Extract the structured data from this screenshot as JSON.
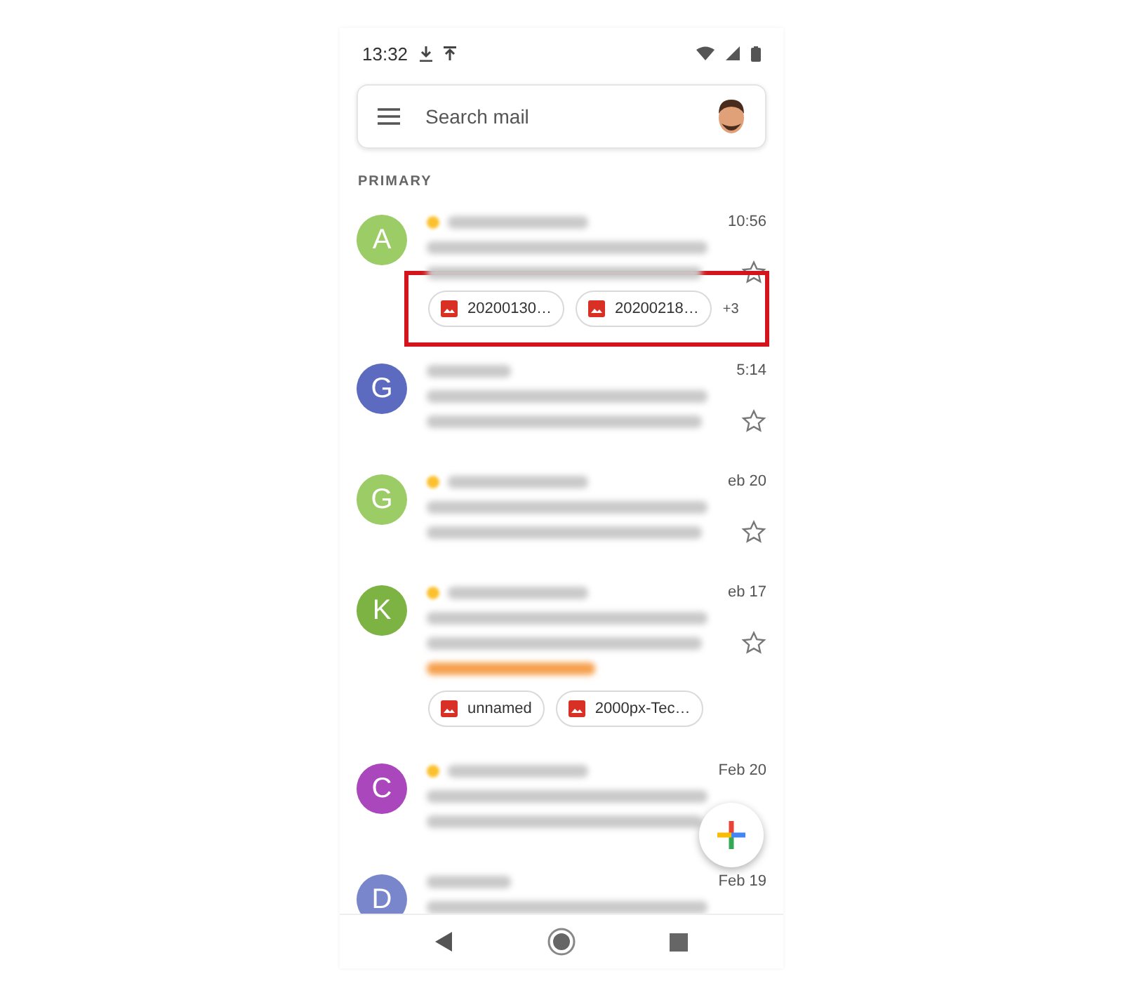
{
  "status_bar": {
    "time": "13:32"
  },
  "search": {
    "placeholder": "Search mail"
  },
  "section_label": "PRIMARY",
  "emails": [
    {
      "avatar": "A",
      "color": "#9ccc65",
      "important": true,
      "time": "10:56",
      "starred": false,
      "attachments": [
        "20200130…",
        "20200218…"
      ],
      "more": "+3",
      "highlighted": true,
      "follow_up": false
    },
    {
      "avatar": "G",
      "color": "#5c6bc0",
      "important": false,
      "time": "5:14",
      "starred": false,
      "highlighted": false,
      "follow_up": false
    },
    {
      "avatar": "G",
      "color": "#9ccc65",
      "important": true,
      "time": "eb 20",
      "starred": false,
      "highlighted": false,
      "follow_up": false
    },
    {
      "avatar": "K",
      "color": "#7cb342",
      "important": true,
      "time": "eb 17",
      "starred": false,
      "attachments": [
        "unnamed",
        "2000px-Tec…"
      ],
      "highlighted": false,
      "follow_up": true
    },
    {
      "avatar": "C",
      "color": "#ab47bc",
      "important": true,
      "time": "Feb 20",
      "highlighted": false,
      "follow_up": false
    },
    {
      "avatar": "D",
      "color": "#7986cb",
      "important": false,
      "time": "Feb 19",
      "highlighted": false,
      "follow_up": false
    }
  ]
}
